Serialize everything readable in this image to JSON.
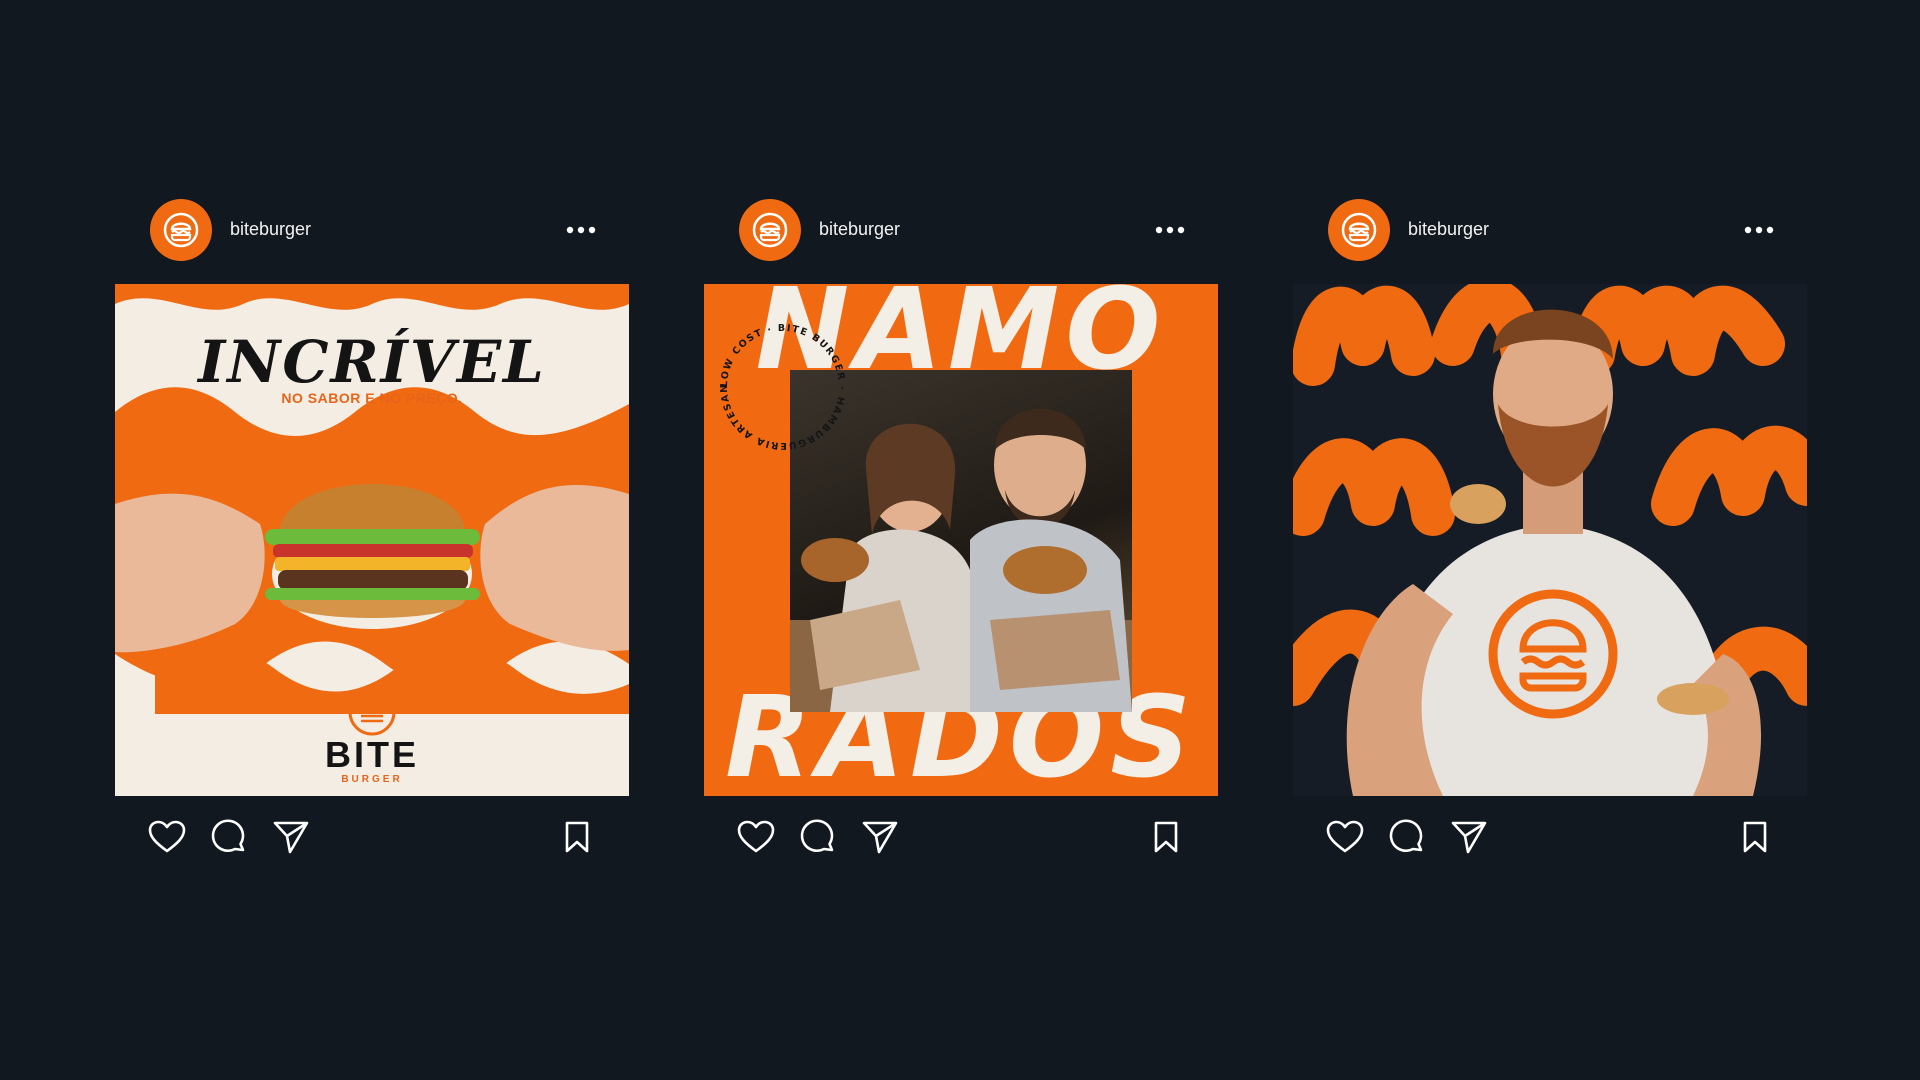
{
  "colors": {
    "background": "#111820",
    "accent": "#f06a12",
    "cream": "#f3ede3"
  },
  "posts": [
    {
      "username": "biteburger",
      "image": {
        "headline": "INCRÍVEL",
        "subheadline": "NO SABOR E NO PREÇO.",
        "brand": "BITE",
        "brand_sub": "BURGER"
      }
    },
    {
      "username": "biteburger",
      "image": {
        "headline_top": "NAMO",
        "headline_bottom": "RADOS",
        "stamp_text": "LOW COST · BITE BURGER · HAMBURGUERIA ARTESANAL ·"
      }
    },
    {
      "username": "biteburger",
      "image": {}
    }
  ],
  "icons": {
    "more": "more-horizontal-icon",
    "like": "heart-icon",
    "comment": "comment-icon",
    "share": "send-icon",
    "save": "bookmark-icon",
    "avatar": "burger-logo-icon"
  }
}
